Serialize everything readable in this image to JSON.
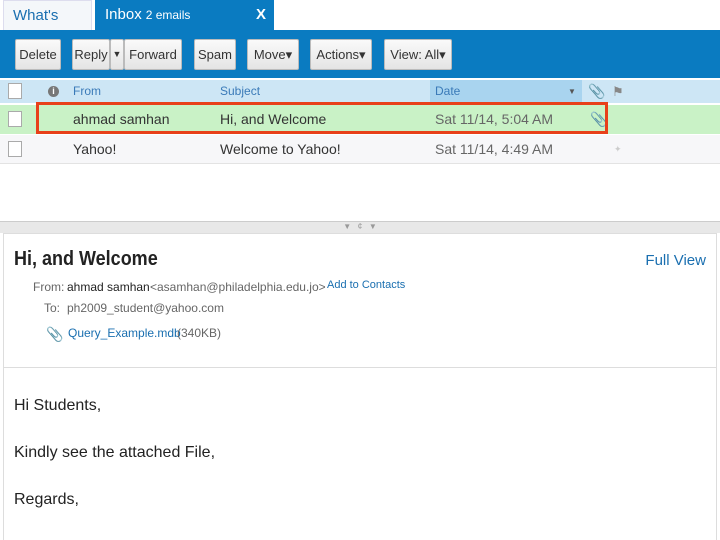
{
  "tabs": [
    {
      "label": "What's New"
    },
    {
      "label": "Inbox",
      "count": "2 emails",
      "close": "X"
    }
  ],
  "toolbar": {
    "delete": "Delete",
    "reply": "Reply",
    "forward": "Forward",
    "spam": "Spam",
    "move": "Move▾",
    "actions": "Actions▾",
    "view": "View: All▾"
  },
  "columns": {
    "from": "From",
    "subject": "Subject",
    "date": "Date"
  },
  "emails": [
    {
      "from": "ahmad samhan",
      "subject": "Hi, and Welcome",
      "date": "Sat 11/14, 5:04 AM",
      "attachment": true,
      "selected": true
    },
    {
      "from": "Yahoo!",
      "subject": "Welcome to Yahoo!",
      "date": "Sat 11/14, 4:49 AM",
      "attachment": false,
      "selected": false
    }
  ],
  "preview": {
    "subject": "Hi, and Welcome",
    "full_view": "Full View",
    "from_label": "From:",
    "from_name": "ahmad samhan",
    "from_email": "<asamhan@philadelphia.edu.jo>",
    "add_contacts": "Add to Contacts",
    "to_label": "To:",
    "to": "ph2009_student@yahoo.com",
    "attachment_name": "Query_Example.mdb",
    "attachment_size": "(340KB)",
    "body": [
      "Hi Students,",
      "Kindly see the attached File,",
      "Regards,"
    ]
  },
  "colors": {
    "accent": "#0a7bc1",
    "selected_row": "#c9f2c6",
    "highlight_box": "#e8401a"
  }
}
